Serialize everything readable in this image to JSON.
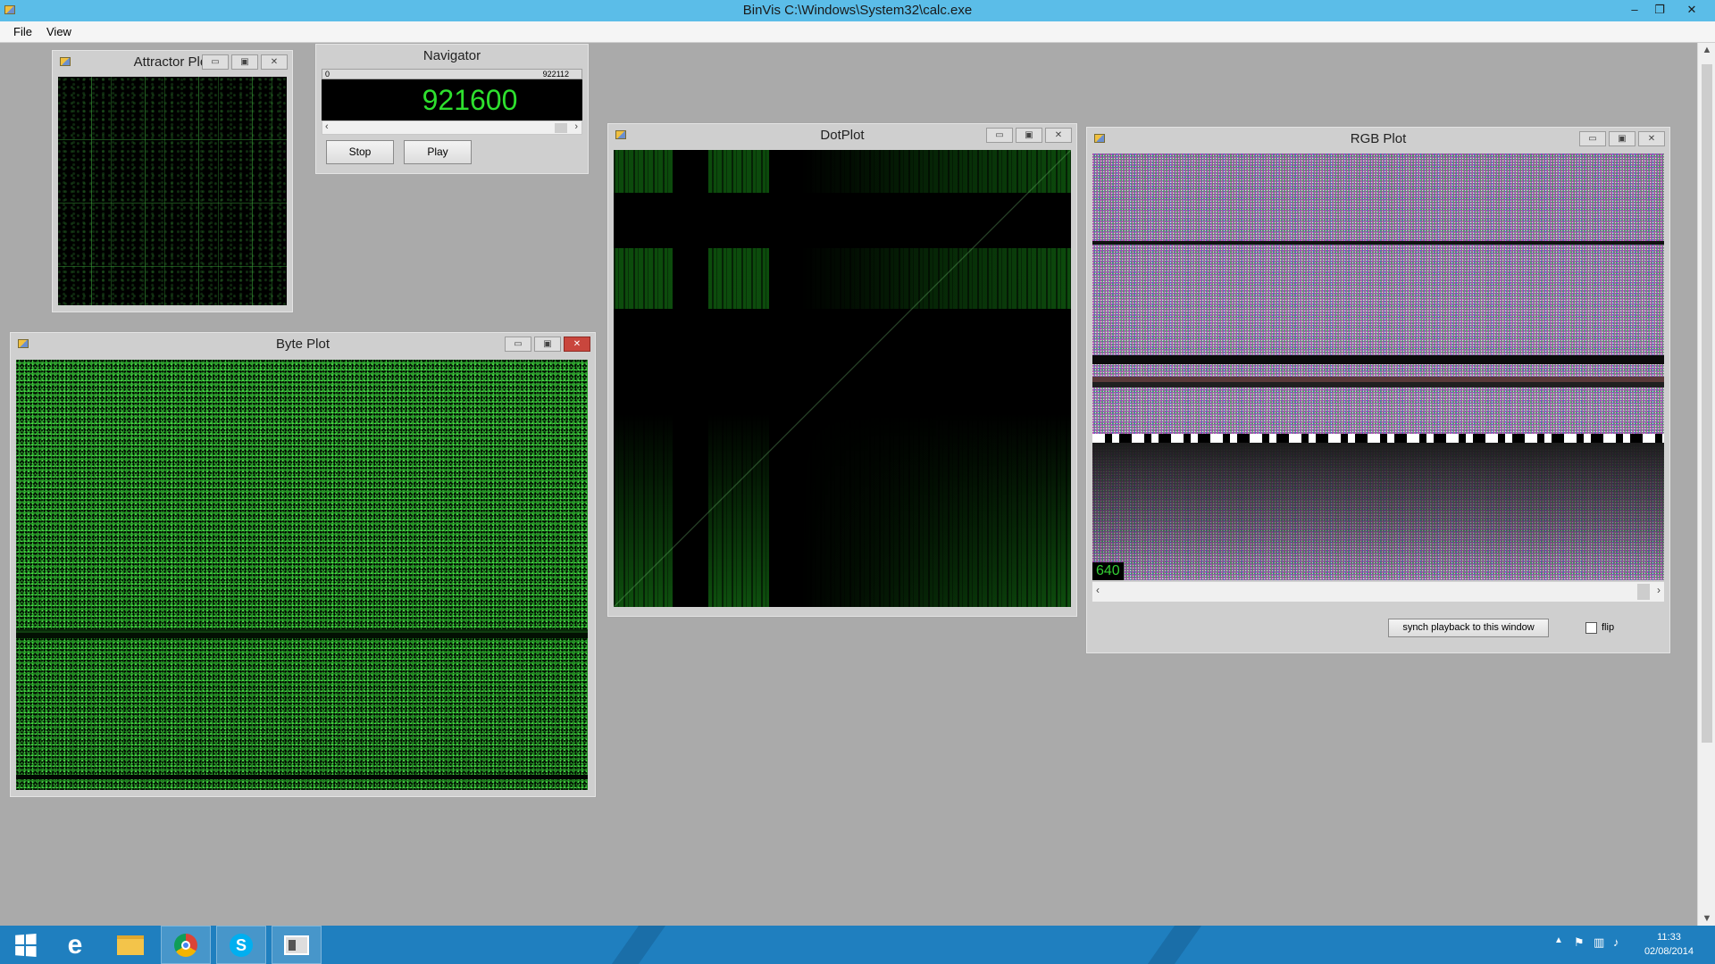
{
  "app": {
    "title": "BinVis C:\\Windows\\System32\\calc.exe",
    "menu": [
      "File",
      "View"
    ],
    "window_controls": {
      "minimize": "–",
      "restore": "❐",
      "close": "✕"
    }
  },
  "windows": {
    "attractor": {
      "title": "Attractor Plot"
    },
    "navigator": {
      "title": "Navigator",
      "range_start": "0",
      "range_end": "922112",
      "position": "921600",
      "stop_label": "Stop",
      "play_label": "Play"
    },
    "dotplot": {
      "title": "DotPlot"
    },
    "byteplot": {
      "title": "Byte Plot"
    },
    "rgbplot": {
      "title": "RGB Plot",
      "width_readout": "640",
      "synch_label": "synch playback to this window",
      "flip_label": "flip",
      "flip_checked": false
    }
  },
  "mdi_buttons": {
    "minimize": "▭",
    "maximize": "▣",
    "close": "✕"
  },
  "taskbar": {
    "icons": [
      "windows-start-icon",
      "internet-explorer-icon",
      "file-explorer-icon",
      "chrome-icon",
      "skype-icon",
      "binvis-icon"
    ],
    "clock_time": "11:33",
    "clock_date": "02/08/2014"
  },
  "colors": {
    "titlebar": "#5bbde8",
    "desktop": "#aaaaaa",
    "taskbar": "#1f7fbf",
    "plot_green": "#2ee02e"
  }
}
